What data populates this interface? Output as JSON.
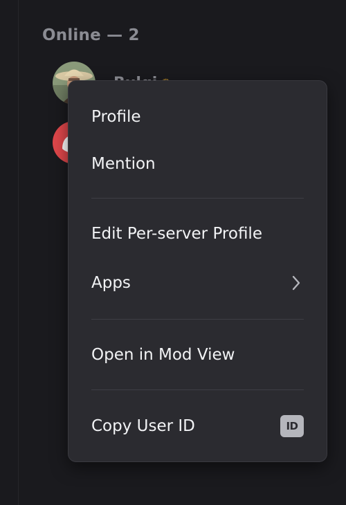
{
  "members_panel": {
    "section_header": "Online — 2",
    "members": [
      {
        "name": "Bulgi",
        "avatar": "cowboy-photo",
        "badge_icon": "crown-icon"
      },
      {
        "name": "",
        "avatar": "discord-default-red"
      }
    ]
  },
  "context_menu": {
    "items": {
      "profile": "Profile",
      "mention": "Mention",
      "edit_profile": "Edit Per-server Profile",
      "apps": "Apps",
      "mod_view": "Open in Mod View",
      "copy_id": "Copy User ID"
    },
    "copy_id_badge": "ID",
    "icons": {
      "apps_submenu": "chevron-right-icon",
      "copy_id": "id-icon"
    }
  },
  "colors": {
    "background": "#1a1a1e",
    "menu_background": "#2b2b30",
    "menu_text": "#f2f3f5",
    "muted_text": "#8b8c93",
    "avatar_red": "#e0474b",
    "crown": "#f0b232"
  }
}
